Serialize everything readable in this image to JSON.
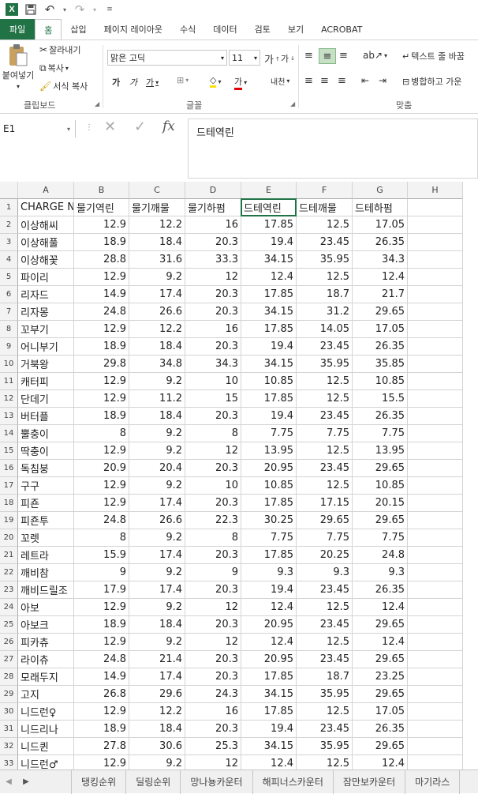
{
  "titlebar": {
    "logo": "X",
    "undo": "↶",
    "redo": "↷"
  },
  "tabs": [
    "파일",
    "홈",
    "삽입",
    "페이지 레이아웃",
    "수식",
    "데이터",
    "검토",
    "보기",
    "ACROBAT"
  ],
  "ribbon": {
    "paste": "붙여넣기",
    "cut": "잘라내기",
    "copy": "복사",
    "format_painter": "서식 복사",
    "clipboard_label": "클립보드",
    "font_name": "맑은 고딕",
    "font_size": "11",
    "font_label": "글꼴",
    "wrap_text": "텍스트 줄 바꿈",
    "merge_center": "병합하고 가운",
    "align_label": "맞춤"
  },
  "formula": {
    "namebox": "E1",
    "content": "드테역린"
  },
  "columns": [
    "A",
    "B",
    "C",
    "D",
    "E",
    "F",
    "G",
    "H"
  ],
  "rows": [
    [
      "CHARGE NAME",
      "물기역린",
      "물기깨물",
      "물기하펌",
      "드테역린",
      "드테깨물",
      "드테하펌"
    ],
    [
      "이상해씨",
      "12.9",
      "12.2",
      "16",
      "17.85",
      "12.5",
      "17.05"
    ],
    [
      "이상해풀",
      "18.9",
      "18.4",
      "20.3",
      "19.4",
      "23.45",
      "26.35"
    ],
    [
      "이상해꽃",
      "28.8",
      "31.6",
      "33.3",
      "34.15",
      "35.95",
      "34.3"
    ],
    [
      "파이리",
      "12.9",
      "9.2",
      "12",
      "12.4",
      "12.5",
      "12.4"
    ],
    [
      "리자드",
      "14.9",
      "17.4",
      "20.3",
      "17.85",
      "18.7",
      "21.7"
    ],
    [
      "리자몽",
      "24.8",
      "26.6",
      "20.3",
      "34.15",
      "31.2",
      "29.65"
    ],
    [
      "꼬부기",
      "12.9",
      "12.2",
      "16",
      "17.85",
      "14.05",
      "17.05"
    ],
    [
      "어니부기",
      "18.9",
      "18.4",
      "20.3",
      "19.4",
      "23.45",
      "26.35"
    ],
    [
      "거북왕",
      "29.8",
      "34.8",
      "34.3",
      "34.15",
      "35.95",
      "35.85"
    ],
    [
      "캐터피",
      "12.9",
      "9.2",
      "10",
      "10.85",
      "12.5",
      "10.85"
    ],
    [
      "단데기",
      "12.9",
      "11.2",
      "15",
      "17.85",
      "12.5",
      "15.5"
    ],
    [
      "버터플",
      "18.9",
      "18.4",
      "20.3",
      "19.4",
      "23.45",
      "26.35"
    ],
    [
      "뿔충이",
      "8",
      "9.2",
      "8",
      "7.75",
      "7.75",
      "7.75"
    ],
    [
      "딱충이",
      "12.9",
      "9.2",
      "12",
      "13.95",
      "12.5",
      "13.95"
    ],
    [
      "독침붕",
      "20.9",
      "20.4",
      "20.3",
      "20.95",
      "23.45",
      "29.65"
    ],
    [
      "구구",
      "12.9",
      "9.2",
      "10",
      "10.85",
      "12.5",
      "10.85"
    ],
    [
      "피죤",
      "12.9",
      "17.4",
      "20.3",
      "17.85",
      "17.15",
      "20.15"
    ],
    [
      "피죤투",
      "24.8",
      "26.6",
      "22.3",
      "30.25",
      "29.65",
      "29.65"
    ],
    [
      "꼬렛",
      "8",
      "9.2",
      "8",
      "7.75",
      "7.75",
      "7.75"
    ],
    [
      "레트라",
      "15.9",
      "17.4",
      "20.3",
      "17.85",
      "20.25",
      "24.8"
    ],
    [
      "깨비참",
      "9",
      "9.2",
      "9",
      "9.3",
      "9.3",
      "9.3"
    ],
    [
      "깨비드릴조",
      "17.9",
      "17.4",
      "20.3",
      "19.4",
      "23.45",
      "26.35"
    ],
    [
      "아보",
      "12.9",
      "9.2",
      "12",
      "12.4",
      "12.5",
      "12.4"
    ],
    [
      "아보크",
      "18.9",
      "18.4",
      "20.3",
      "20.95",
      "23.45",
      "29.65"
    ],
    [
      "피카츄",
      "12.9",
      "9.2",
      "12",
      "12.4",
      "12.5",
      "12.4"
    ],
    [
      "라이츄",
      "24.8",
      "21.4",
      "20.3",
      "20.95",
      "23.45",
      "29.65"
    ],
    [
      "모래두지",
      "14.9",
      "17.4",
      "20.3",
      "17.85",
      "18.7",
      "23.25"
    ],
    [
      "고지",
      "26.8",
      "29.6",
      "24.3",
      "34.15",
      "35.95",
      "29.65"
    ],
    [
      "니드런♀",
      "12.9",
      "12.2",
      "16",
      "17.85",
      "12.5",
      "17.05"
    ],
    [
      "니드리나",
      "18.9",
      "18.4",
      "20.3",
      "19.4",
      "23.45",
      "26.35"
    ],
    [
      "니드퀸",
      "27.8",
      "30.6",
      "25.3",
      "34.15",
      "35.95",
      "29.65"
    ],
    [
      "니드런♂",
      "12.9",
      "9.2",
      "12",
      "12.4",
      "12.5",
      "12.4"
    ]
  ],
  "sheets": [
    "탱킹순위",
    "딜링순위",
    "망나뇽카운터",
    "해피너스카운터",
    "잠만보카운터",
    "마기라스"
  ]
}
